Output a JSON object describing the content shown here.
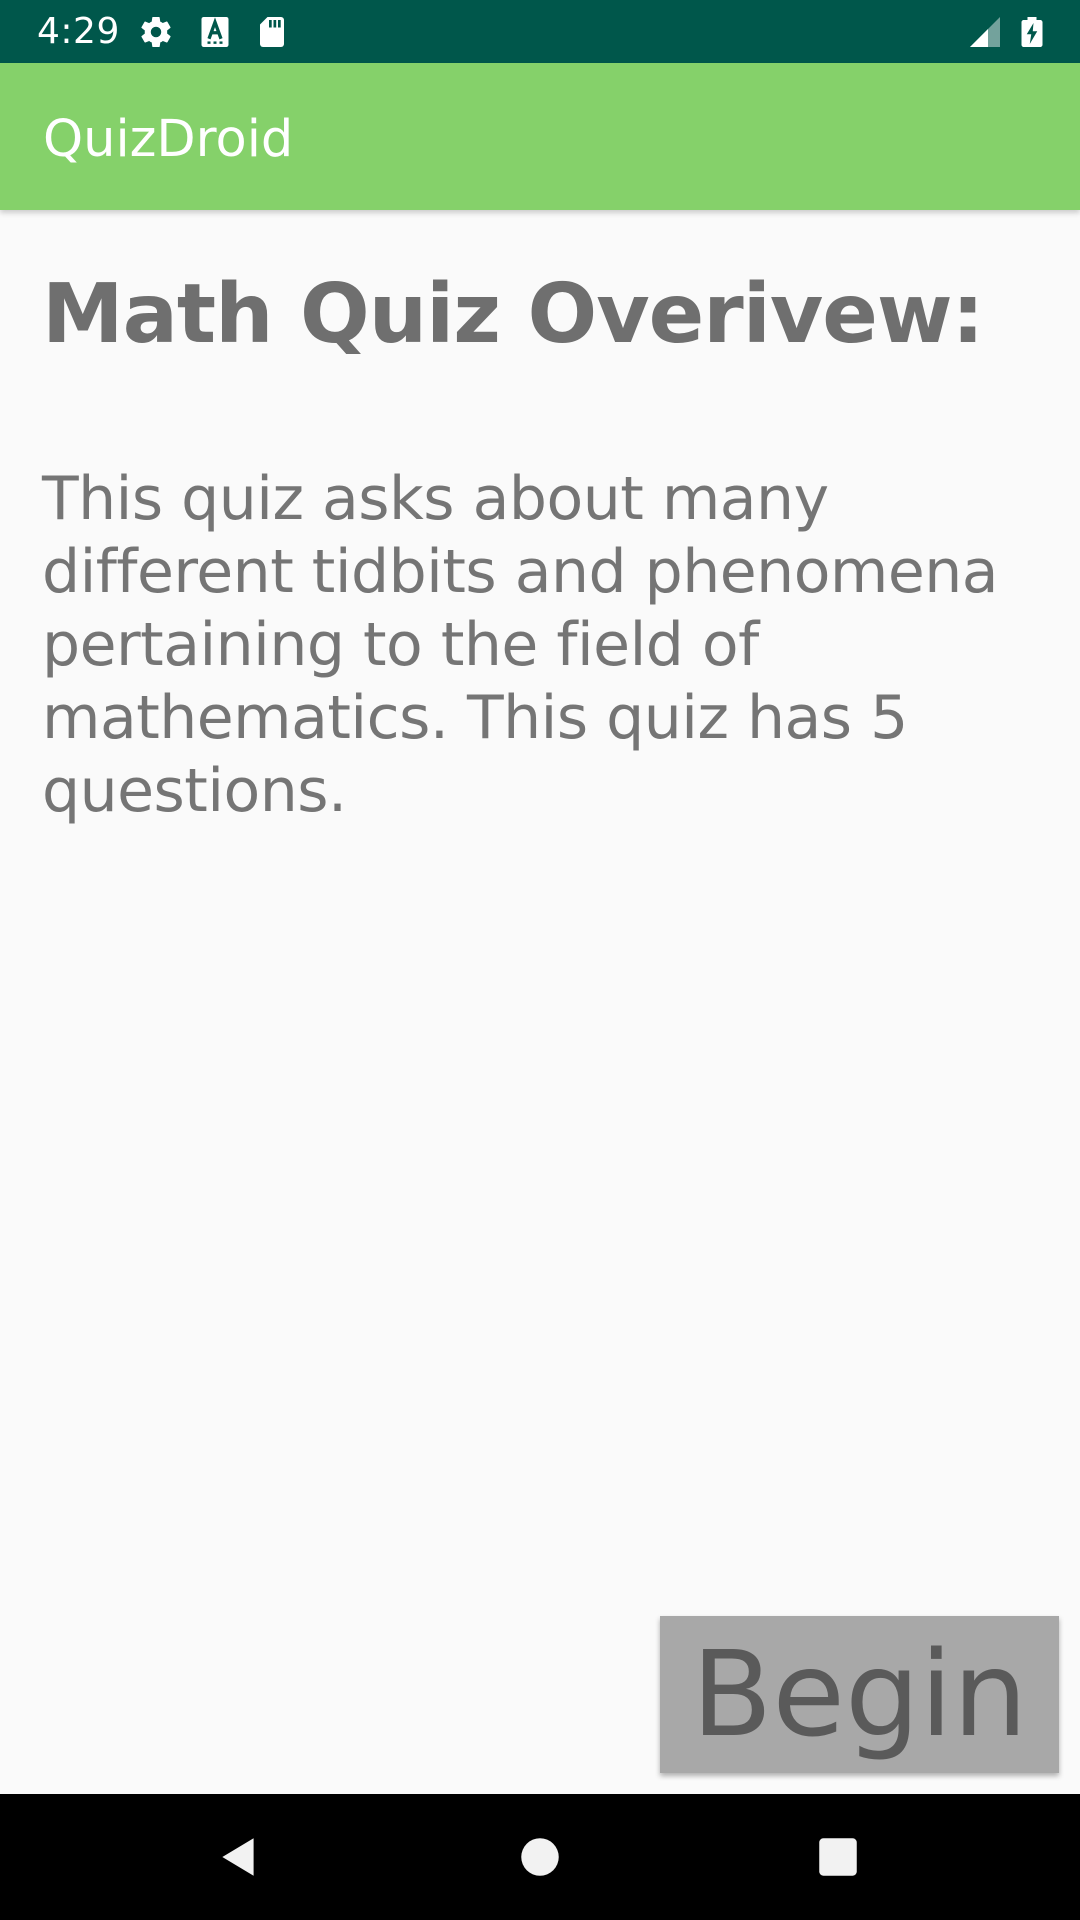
{
  "status_bar": {
    "time": "4:29",
    "icons": [
      "settings-gear-icon",
      "a-keyboard-icon",
      "sd-card-icon",
      "signal-icon",
      "battery-charging-icon"
    ],
    "color": "#00574b"
  },
  "app_bar": {
    "title": "QuizDroid",
    "color": "#85d16a"
  },
  "content": {
    "heading": "Math Quiz Overivew:",
    "description": "This quiz asks about many different tidbits and phenomena pertaining to the field of mathematics. This quiz has 5 questions."
  },
  "begin_button": {
    "label": "Begin",
    "color": "#a8a8a8"
  },
  "nav_bar": {
    "buttons": [
      "back-icon",
      "home-icon",
      "recents-icon"
    ]
  }
}
